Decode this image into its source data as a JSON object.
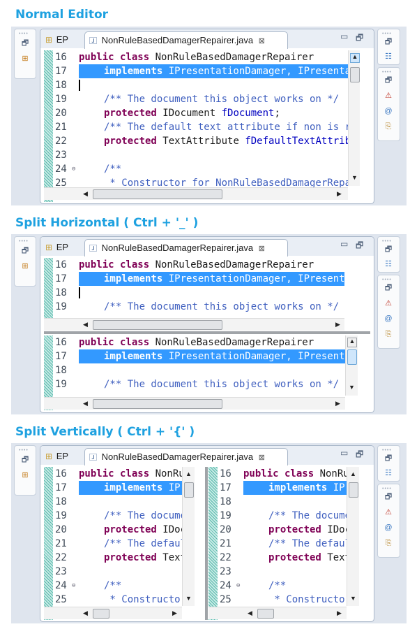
{
  "sections": [
    {
      "heading": "Normal Editor"
    },
    {
      "heading": "Split Horizontal ( Ctrl  + '_' )"
    },
    {
      "heading": "Split Vertically ( Ctrl + '{' )"
    }
  ],
  "tabs": {
    "first": "EP",
    "second": "NonRuleBasedDamagerRepairer.java",
    "close": "⊠"
  },
  "line_numbers": [
    "16",
    "17",
    "18",
    "19",
    "20",
    "21",
    "22",
    "23",
    "24",
    "25"
  ],
  "code": {
    "l16_kw": "public class ",
    "l16_name": "NonRuleBasedDamagerRepairer",
    "l17_kw": "implements ",
    "l17_rest": "IPresentationDamager, IPresentationRepairer {",
    "l19": "/** The document this object works on */",
    "l20_kw": "protected ",
    "l20_type": "IDocument ",
    "l20_field": "fDocument",
    "l20_end": ";",
    "l21": "/** The default text attribute if non is returned as data by the current token */",
    "l22_kw": "protected ",
    "l22_type": "TextAttribute ",
    "l22_field": "fDefaultTextAttribute",
    "l22_end": ";",
    "l24": "/**",
    "l25": " * Constructor for NonRuleBasedDamagerRepairer."
  },
  "colors": {
    "heading": "#1ea1e0",
    "selection": "#3399ff",
    "keyword": "#7f0055",
    "comment": "#3f5fbf",
    "field": "#0000c0"
  },
  "icons": {
    "left_toolbar": [
      "restore-icon",
      "hierarchy-icon"
    ],
    "right_toolbar_top": [
      "restore-icon",
      "outline-icon"
    ],
    "right_toolbar_bottom": [
      "restore-icon",
      "problems-icon",
      "javadoc-icon",
      "declaration-icon"
    ]
  }
}
